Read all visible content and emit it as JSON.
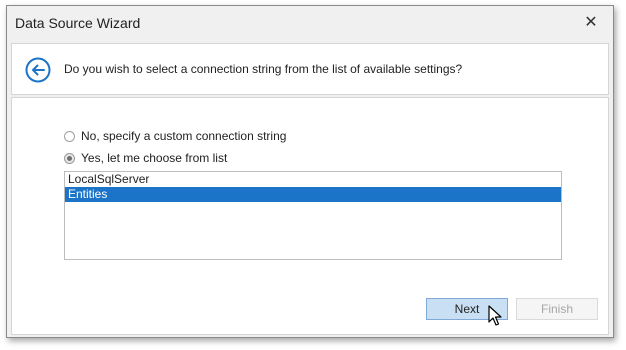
{
  "window": {
    "title": "Data Source Wizard",
    "close_glyph": "✕"
  },
  "header": {
    "back_icon": "back-arrow-icon",
    "question": "Do you wish to select a connection string from the list of available settings?"
  },
  "options": [
    {
      "label": "No, specify a custom connection string",
      "checked": false
    },
    {
      "label": "Yes, let me choose from list",
      "checked": true
    }
  ],
  "connections": {
    "items": [
      {
        "label": "LocalSqlServer",
        "selected": false
      },
      {
        "label": "Entities",
        "selected": true
      }
    ]
  },
  "buttons": {
    "next": "Next",
    "finish": "Finish"
  },
  "colors": {
    "accent": "#1c74c8",
    "next_button_bg": "#c9dff4",
    "selection_bg": "#1c74c8"
  }
}
